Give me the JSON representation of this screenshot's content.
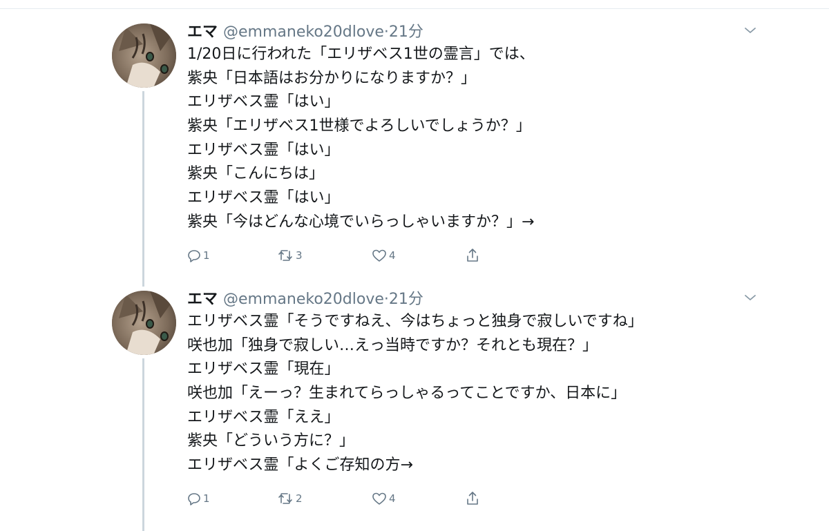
{
  "tweets": [
    {
      "name": "エマ",
      "handle": "@emmaneko20dlove",
      "dot": "·",
      "time": "21分",
      "lines": [
        "1/20日に行われた「エリザベス1世の霊言」では、",
        "紫央「日本語はお分かりになりますか？」",
        "エリザベス霊「はい」",
        "紫央「エリザベス1世様でよろしいでしょうか？」",
        "エリザベス霊「はい」",
        "紫央「こんにちは」",
        "エリザベス霊「はい」",
        "紫央「今はどんな心境でいらっしゃいますか？」→"
      ],
      "actions": {
        "reply_count": "1",
        "retweet_count": "3",
        "like_count": "4"
      }
    },
    {
      "name": "エマ",
      "handle": "@emmaneko20dlove",
      "dot": "·",
      "time": "21分",
      "lines": [
        "エリザベス霊「そうですねえ、今はちょっと独身で寂しいですね」",
        "咲也加「独身で寂しい…えっ当時ですか？それとも現在？」",
        "エリザベス霊「現在」",
        "咲也加「えーっ？生まれてらっしゃるってことですか、日本に」",
        "エリザベス霊「ええ」",
        "紫央「どういう方に？」",
        "エリザベス霊「よくご存知の方→"
      ],
      "actions": {
        "reply_count": "1",
        "retweet_count": "2",
        "like_count": "4"
      }
    }
  ],
  "icons": {
    "caret": "chevron-down-icon",
    "reply": "reply-icon",
    "retweet": "retweet-icon",
    "like": "heart-icon",
    "share": "share-icon"
  },
  "colors": {
    "text": "#14171a",
    "secondary": "#657786",
    "thread_line": "#ccd6dd",
    "divider": "#e6ecf0"
  }
}
